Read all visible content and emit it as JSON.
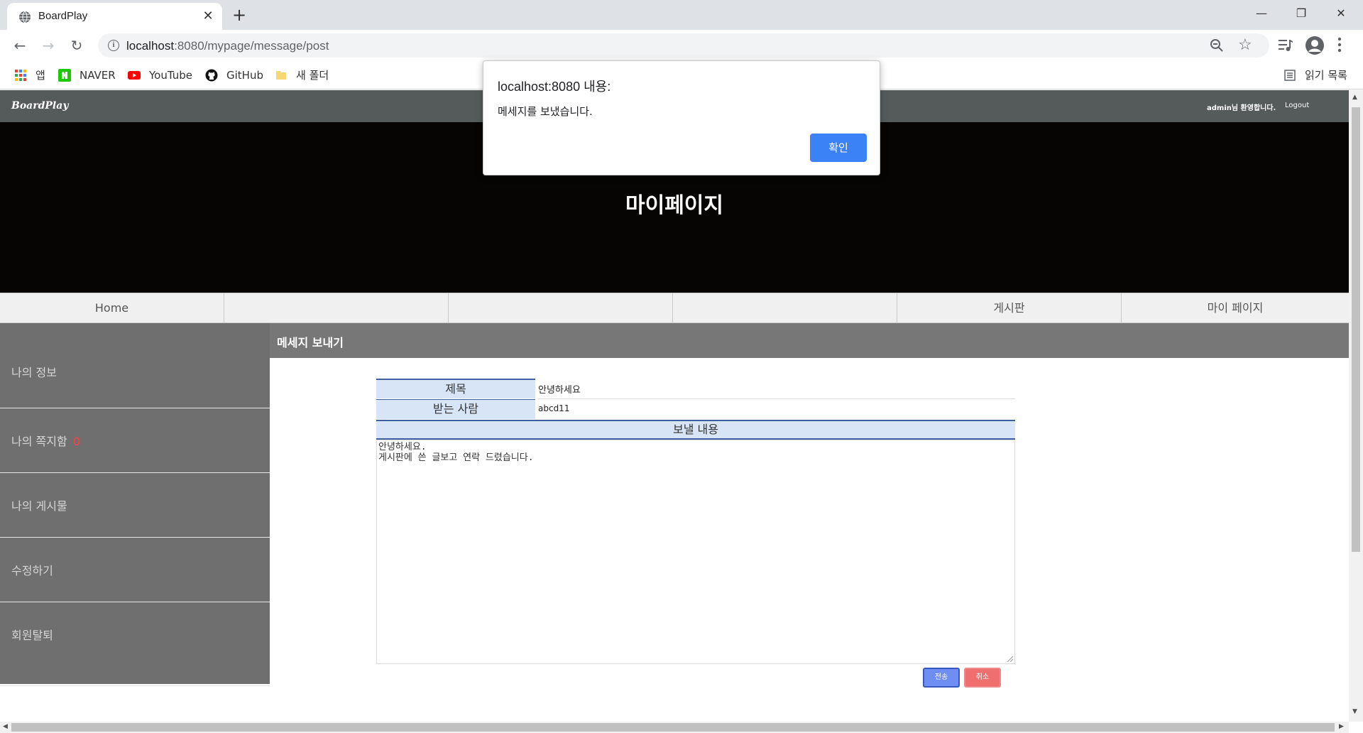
{
  "browser": {
    "tab_title": "BoardPlay",
    "tab_close": "✕",
    "new_tab": "+",
    "url_host": "localhost",
    "url_rest": ":8080/mypage/message/post",
    "window_controls": {
      "minimize": "—",
      "maximize": "❐",
      "close": "✕"
    },
    "bookmarks": [
      {
        "label": "앱",
        "icon": "apps-grid-icon"
      },
      {
        "label": "NAVER",
        "icon": "naver-icon"
      },
      {
        "label": "YouTube",
        "icon": "youtube-icon"
      },
      {
        "label": "GitHub",
        "icon": "github-icon"
      },
      {
        "label": "새 폴더",
        "icon": "folder-icon"
      }
    ],
    "reading_list": "읽기 목록"
  },
  "site": {
    "logo": "BoardPlay",
    "welcome": "admin님 환영합니다.",
    "logout": "Logout",
    "hero_title": "마이페이지",
    "menu": [
      "Home",
      "",
      "",
      "",
      "게시판",
      "마이 페이지"
    ]
  },
  "sidebar": {
    "items": [
      {
        "label": "나의 정보"
      },
      {
        "label": "나의 쪽지함",
        "count": "0"
      },
      {
        "label": "나의 게시물"
      },
      {
        "label": "수정하기"
      },
      {
        "label": "회원탈퇴"
      }
    ]
  },
  "content": {
    "title": "메세지 보내기",
    "form": {
      "subject_label": "제목",
      "subject_value": "안녕하세요",
      "recipient_label": "받는 사람",
      "recipient_value": "abcd11",
      "body_label": "보낼 내용",
      "body_value": "안녕하세요.\n게시판에 쓴 글보고 연락 드렸습니다.",
      "send_button": "전송",
      "cancel_button": "취소"
    }
  },
  "alert": {
    "title": "localhost:8080 내용:",
    "message": "메세지를 보냈습니다.",
    "ok": "확인"
  },
  "colors": {
    "nav_bg": "#555b5a",
    "hero_bg": "#070504",
    "sidebar_bg": "#6f6f6f",
    "content_header_bg": "#777777",
    "label_bg": "#d8e5f6",
    "send_button": "#6e8ef4",
    "cancel_button": "#ef6e6e",
    "alert_ok": "#3b82f6",
    "count_red": "#ff4040"
  }
}
